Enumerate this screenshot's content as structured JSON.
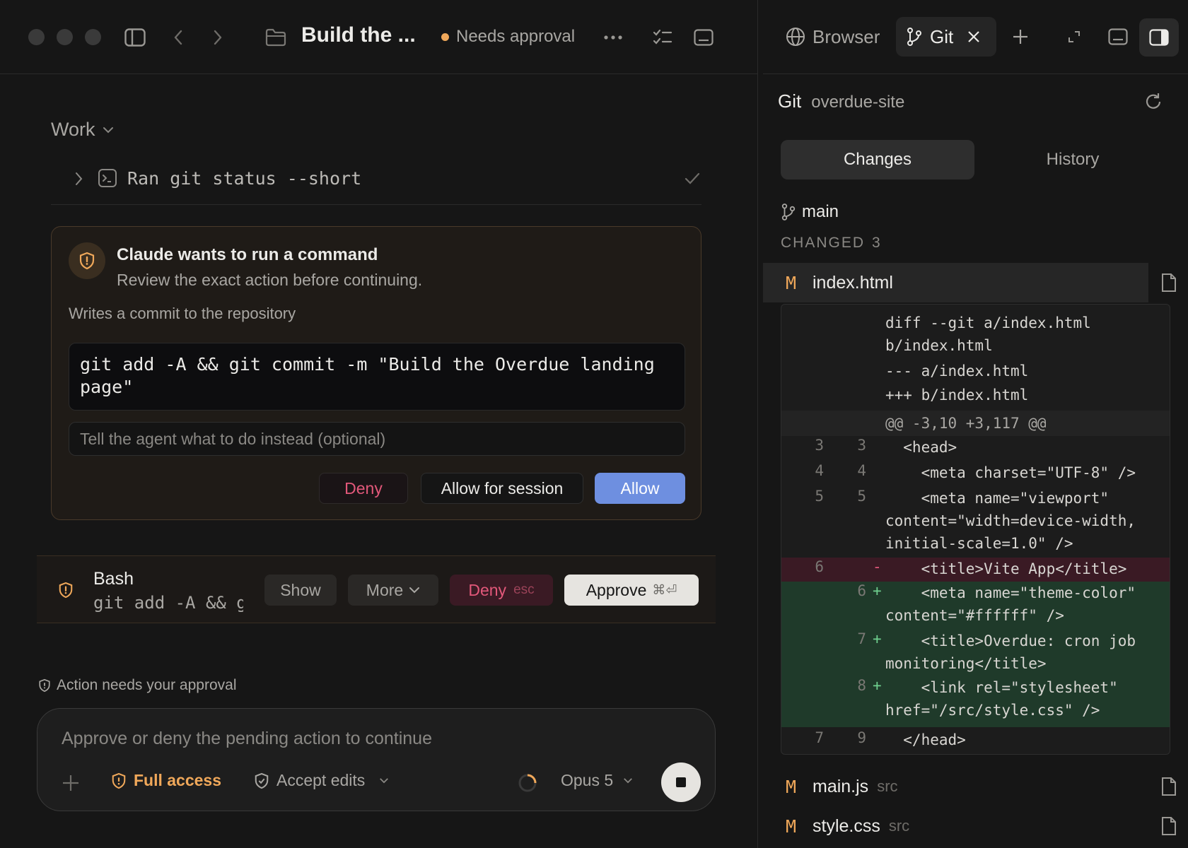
{
  "window": {
    "title": "Build the ...",
    "status": "Needs approval"
  },
  "work": {
    "label": "Work",
    "ran_label": "Ran git status --short"
  },
  "approval_card": {
    "title": "Claude wants to run a command",
    "subtitle": "Review the exact action before continuing.",
    "description": "Writes a commit to the repository",
    "command_line1": "git add -A && git commit -m \"Build the Overdue landing",
    "command_line2": "page\"",
    "instead_placeholder": "Tell the agent what to do instead (optional)",
    "deny_label": "Deny",
    "allow_session_label": "Allow for session",
    "allow_label": "Allow"
  },
  "bash_bar": {
    "tool": "Bash",
    "command": "git add -A && git commit",
    "show_label": "Show",
    "more_label": "More",
    "deny_label": "Deny",
    "deny_shortcut": "esc",
    "approve_label": "Approve",
    "approve_shortcut": "⌘⏎"
  },
  "composer": {
    "notice": "Action needs your approval",
    "placeholder": "Approve or deny the pending action to continue",
    "full_access_label": "Full access",
    "accept_edits_label": "Accept edits",
    "model_label": "Opus 5"
  },
  "right_panel": {
    "tabs": [
      {
        "label": "Browser"
      },
      {
        "label": "Git"
      }
    ],
    "git_title": "Git",
    "repo": "overdue-site",
    "seg_changes": "Changes",
    "seg_history": "History",
    "branch": "main",
    "changed_label": "CHANGED",
    "changed_count": "3",
    "files": [
      {
        "status": "M",
        "name": "index.html",
        "dir": ""
      },
      {
        "status": "M",
        "name": "main.js",
        "dir": "src"
      },
      {
        "status": "M",
        "name": "style.css",
        "dir": "src"
      }
    ],
    "diff": {
      "header": [
        "diff --git a/index.html",
        "b/index.html",
        "--- a/index.html",
        "+++ b/index.html"
      ],
      "hunk": "@@ -3,10 +3,117 @@",
      "lines": [
        {
          "old": "3",
          "new": "3",
          "sign": "",
          "text": "  <head>"
        },
        {
          "old": "4",
          "new": "4",
          "sign": "",
          "text": "    <meta charset=\"UTF-8\" />"
        },
        {
          "old": "5",
          "new": "5",
          "sign": "",
          "text": "    <meta name=\"viewport\"\ncontent=\"width=device-width,\ninitial-scale=1.0\" />"
        },
        {
          "old": "6",
          "new": "",
          "sign": "-",
          "text": "    <title>Vite App</title>"
        },
        {
          "old": "",
          "new": "6",
          "sign": "+",
          "text": "    <meta name=\"theme-color\"\ncontent=\"#ffffff\" />"
        },
        {
          "old": "",
          "new": "7",
          "sign": "+",
          "text": "    <title>Overdue: cron job\nmonitoring</title>"
        },
        {
          "old": "",
          "new": "8",
          "sign": "+",
          "text": "    <link rel=\"stylesheet\"\nhref=\"/src/style.css\" />"
        },
        {
          "old": "7",
          "new": "9",
          "sign": "",
          "text": "  </head>"
        }
      ]
    }
  },
  "colors": {
    "accent_orange": "#f0a85a",
    "allow_blue": "#6e8fe0",
    "deny_red": "#e2587a",
    "add_green": "#1f3a2a",
    "del_red": "#3a1a24"
  }
}
